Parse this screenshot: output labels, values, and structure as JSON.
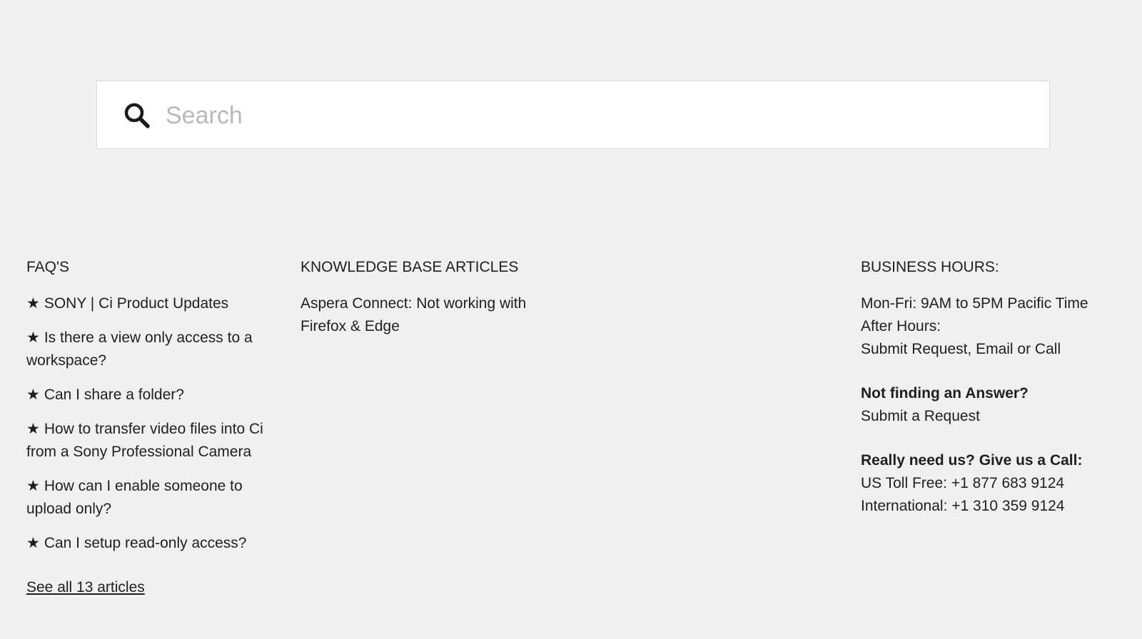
{
  "search": {
    "placeholder": "Search"
  },
  "faq": {
    "title": "FAQ'S",
    "star": "★",
    "items": [
      "SONY | Ci Product Updates",
      "Is there a view only access to a workspace?",
      "Can I share a folder?",
      "How to transfer video files into Ci from a Sony Professional Camera",
      "How can I enable someone to upload only?",
      "Can I setup read-only access?"
    ],
    "see_all": "See all 13 articles"
  },
  "kb": {
    "title": "KNOWLEDGE BASE ARTICLES",
    "items": [
      "Aspera Connect: Not working with Firefox & Edge"
    ]
  },
  "hours": {
    "title": "BUSINESS HOURS:",
    "line1": "Mon-Fri: 9AM to 5PM Pacific Time",
    "line2": "After Hours:",
    "line3": "Submit Request, Email or Call",
    "not_finding": "Not finding an Answer?",
    "submit_request": "Submit a Request",
    "call_heading": "Really need us? Give us a Call:",
    "us_toll_free": "US Toll Free: +1 877 683 9124",
    "international": "International: +1 310 359 9124"
  }
}
